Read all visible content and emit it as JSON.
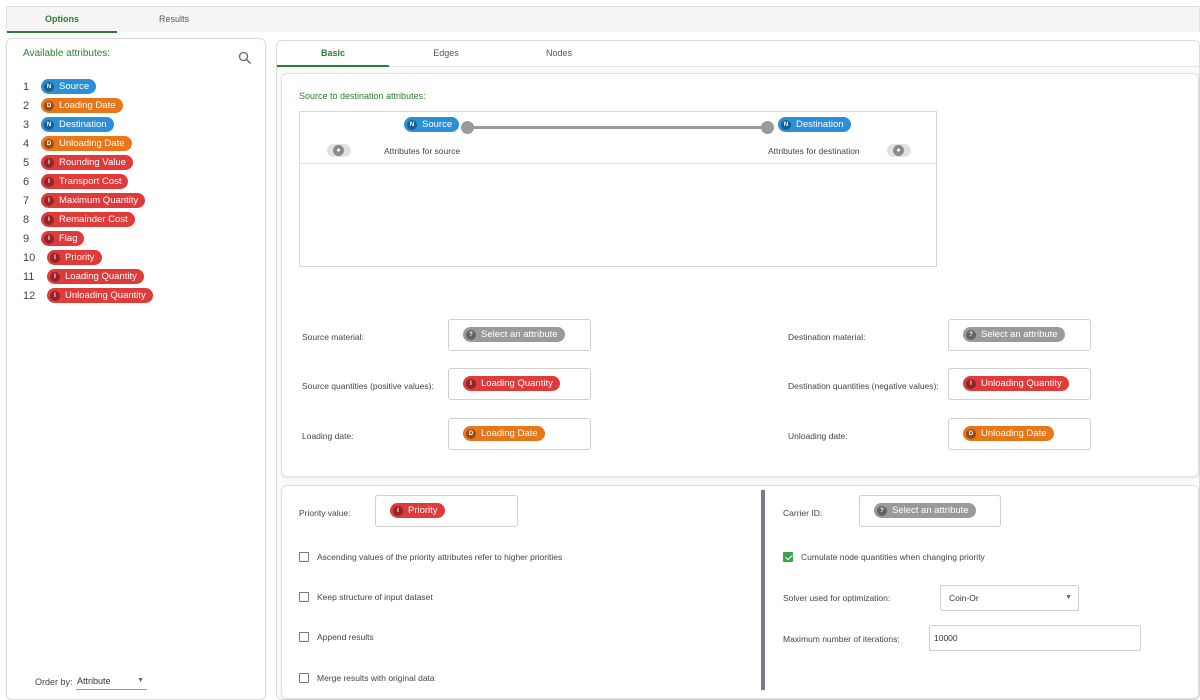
{
  "top_tabs": [
    {
      "label": "Options",
      "active": true
    },
    {
      "label": "Results",
      "active": false
    }
  ],
  "left_panel": {
    "title": "Available attributes:",
    "search_icon": "search-icon",
    "attributes": [
      {
        "num": "1",
        "type": "N",
        "label": "Source"
      },
      {
        "num": "2",
        "type": "D",
        "label": "Loading Date"
      },
      {
        "num": "3",
        "type": "N",
        "label": "Destination"
      },
      {
        "num": "4",
        "type": "D",
        "label": "Unloading Date"
      },
      {
        "num": "5",
        "type": "I",
        "label": "Rounding Value"
      },
      {
        "num": "6",
        "type": "I",
        "label": "Transport Cost"
      },
      {
        "num": "7",
        "type": "I",
        "label": "Maximum Quantity"
      },
      {
        "num": "8",
        "type": "I",
        "label": "Remainder Cost"
      },
      {
        "num": "9",
        "type": "I",
        "label": "Flag"
      },
      {
        "num": "10",
        "type": "I",
        "label": "Priority"
      },
      {
        "num": "11",
        "type": "I",
        "label": "Loading Quantity"
      },
      {
        "num": "12",
        "type": "I",
        "label": "Unloading Quantity"
      }
    ],
    "order_by_label": "Order by:",
    "order_by_value": "Attribute"
  },
  "sub_tabs": [
    {
      "label": "Basic",
      "active": true
    },
    {
      "label": "Edges",
      "active": false
    },
    {
      "label": "Nodes",
      "active": false
    }
  ],
  "mapping": {
    "title": "Source to destination attributes:",
    "source_type": "N",
    "source_label": "Source",
    "dest_type": "N",
    "dest_label": "Destination",
    "attrs_source": "Attributes for source",
    "attrs_dest": "Attributes for destination"
  },
  "fields": {
    "source_material": {
      "label": "Source material:",
      "type": "?",
      "value": "Select an attribute"
    },
    "destination_material": {
      "label": "Destination material:",
      "type": "?",
      "value": "Select an attribute"
    },
    "source_quantities": {
      "label": "Source quantities (positive values):",
      "type": "I",
      "value": "Loading Quantity"
    },
    "destination_quantities": {
      "label": "Destination quantities (negative values):",
      "type": "I",
      "value": "Unloading Quantity"
    },
    "loading_date": {
      "label": "Loading date:",
      "type": "D",
      "value": "Loading Date"
    },
    "unloading_date": {
      "label": "Unloading date:",
      "type": "D",
      "value": "Unloading Date"
    }
  },
  "lower": {
    "priority_label": "Priority value:",
    "priority_type": "I",
    "priority_value": "Priority",
    "carrier_label": "Carrier ID:",
    "carrier_type": "?",
    "carrier_value": "Select an attribute",
    "checkboxes": [
      {
        "label": "Ascending values of the priority attributes refer to higher priorities",
        "checked": false
      },
      {
        "label": "Keep structure of input dataset",
        "checked": false
      },
      {
        "label": "Append results",
        "checked": false
      },
      {
        "label": "Merge results with original data",
        "checked": false
      }
    ],
    "cumulate": {
      "label": "Cumulate node quantities when changing priority",
      "checked": true
    },
    "solver_label": "Solver used for optimization:",
    "solver_value": "Coin-Or",
    "max_iter_label": "Maximum number of iterations:",
    "max_iter_value": "10000"
  },
  "colors": {
    "accent": "#2e7d32",
    "nominal": "#2b8fd8",
    "date": "#e8761a",
    "integer": "#df3b3b",
    "undefined": "#9a9a9a"
  }
}
